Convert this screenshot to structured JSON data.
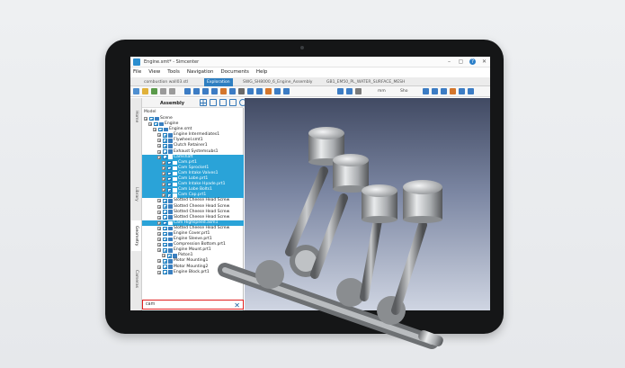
{
  "app": {
    "title": "Engine.smt* - Simcenter",
    "accent_color": "#2e7fc1",
    "window_controls": [
      "minimize-icon",
      "maximize-icon",
      "help-icon",
      "close-icon"
    ]
  },
  "menu": [
    "File",
    "View",
    "Tools",
    "Navigation",
    "Documents",
    "Help"
  ],
  "document_tabs": [
    {
      "label": "combustion wall03.stl",
      "active": false
    },
    {
      "label": "Exploration",
      "active": true
    },
    {
      "label": "SWG_SH8000_6_Engine_Assembly",
      "active": false
    },
    {
      "label": "GB1_EM50_PL_WATER_SURFACE_MESH",
      "active": false
    }
  ],
  "toolbar": {
    "zoom_label": "mm",
    "view_label": "Sho"
  },
  "side_tabs": [
    "Home",
    "Library",
    "Geometry",
    "Cameras"
  ],
  "panel": {
    "title": "Assembly",
    "filter_label": "Model"
  },
  "tree": [
    {
      "level": 0,
      "label": "Scene",
      "selected": false,
      "icon_color": "#3a7fc0"
    },
    {
      "level": 1,
      "label": "Engine",
      "selected": false,
      "icon_color": "#3a7fc0"
    },
    {
      "level": 2,
      "label": "Engine.smt",
      "selected": false,
      "icon_color": "#3a7fc0"
    },
    {
      "level": 3,
      "label": "Engine Intermediates1",
      "selected": false,
      "icon_color": "#3a7fc0"
    },
    {
      "level": 3,
      "label": "Flywheel.smt1",
      "selected": false,
      "icon_color": "#3a7fc0"
    },
    {
      "level": 3,
      "label": "Clutch Retainer1",
      "selected": false,
      "icon_color": "#3a7fc0"
    },
    {
      "level": 3,
      "label": "Exhaust Systemsubs1",
      "selected": false,
      "icon_color": "#3a7fc0"
    },
    {
      "level": 3,
      "label": "Camshaft",
      "selected": true,
      "icon_color": "#ffffff"
    },
    {
      "level": 4,
      "label": "Cam.prt1",
      "selected": true,
      "icon_color": "#ffffff"
    },
    {
      "level": 4,
      "label": "Cam Sprocket1",
      "selected": true,
      "icon_color": "#ffffff"
    },
    {
      "level": 4,
      "label": "Cam Intake Valves1",
      "selected": true,
      "icon_color": "#ffffff"
    },
    {
      "level": 4,
      "label": "Cam Lobe.prt1",
      "selected": true,
      "icon_color": "#ffffff"
    },
    {
      "level": 4,
      "label": "Cam Intake Hpade.prt1",
      "selected": true,
      "icon_color": "#ffffff"
    },
    {
      "level": 4,
      "label": "Cam Lobe Bolts1",
      "selected": true,
      "icon_color": "#ffffff"
    },
    {
      "level": 4,
      "label": "Cam Cap.prt1",
      "selected": true,
      "icon_color": "#ffffff"
    },
    {
      "level": 3,
      "label": "Slotted Cheese Head Screw",
      "selected": false,
      "icon_color": "#3a7fc0"
    },
    {
      "level": 3,
      "label": "Slotted Cheese Head Screw",
      "selected": false,
      "icon_color": "#3a7fc0"
    },
    {
      "level": 3,
      "label": "Slotted Cheese Head Screw",
      "selected": false,
      "icon_color": "#3a7fc0"
    },
    {
      "level": 3,
      "label": "Slotted Cheese Head Screw",
      "selected": false,
      "icon_color": "#3a7fc0"
    },
    {
      "level": 3,
      "label": "Cam Highspeed.asm1",
      "selected": true,
      "icon_color": "#ffffff"
    },
    {
      "level": 3,
      "label": "Slotted Cheese Head Screw",
      "selected": false,
      "icon_color": "#3a7fc0"
    },
    {
      "level": 3,
      "label": "Engine Cover.prt1",
      "selected": false,
      "icon_color": "#3a7fc0"
    },
    {
      "level": 3,
      "label": "Engine Sleeve.prt1",
      "selected": false,
      "icon_color": "#3a7fc0"
    },
    {
      "level": 3,
      "label": "Compression Bottom.prt1",
      "selected": false,
      "icon_color": "#3a7fc0"
    },
    {
      "level": 3,
      "label": "Engine Mount.prt1",
      "selected": false,
      "icon_color": "#3a7fc0"
    },
    {
      "level": 4,
      "label": "Piston1",
      "selected": false,
      "icon_color": "#3a7fc0"
    },
    {
      "level": 3,
      "label": "Motor Mounting1",
      "selected": false,
      "icon_color": "#3a7fc0"
    },
    {
      "level": 3,
      "label": "Motor Mounting2",
      "selected": false,
      "icon_color": "#3a7fc0"
    },
    {
      "level": 3,
      "label": "Engine Block.prt1",
      "selected": false,
      "icon_color": "#3a7fc0"
    }
  ],
  "search": {
    "value": "cam",
    "clear_icon": "close-icon"
  },
  "viewport": {
    "model_icon": "engine-crankshaft-pistons-3d-model"
  }
}
